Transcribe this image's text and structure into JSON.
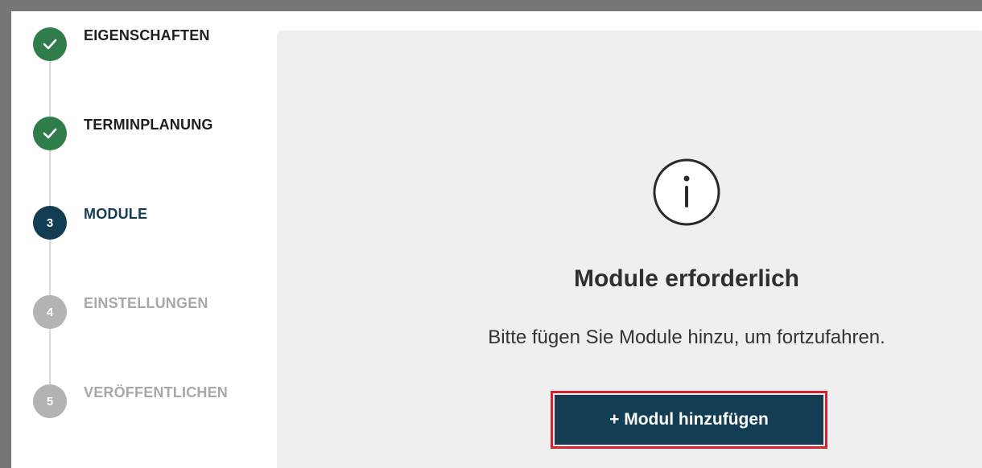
{
  "stepper": {
    "steps": [
      {
        "number": "",
        "label": "EIGENSCHAFTEN",
        "state": "done",
        "icon": "check-icon"
      },
      {
        "number": "",
        "label": "TERMINPLANUNG",
        "state": "done",
        "icon": "check-icon"
      },
      {
        "number": "3",
        "label": "MODULE",
        "state": "current"
      },
      {
        "number": "4",
        "label": "EINSTELLUNGEN",
        "state": "todo"
      },
      {
        "number": "5",
        "label": "VERÖFFENTLICHEN",
        "state": "todo"
      }
    ]
  },
  "main": {
    "icon": "info-icon",
    "title": "Module erforderlich",
    "message": "Bitte fügen Sie Module hinzu, um fortzufahren.",
    "add_button_label": "+ Modul hinzufügen"
  },
  "colors": {
    "done": "#2e7d4a",
    "current": "#123d52",
    "todo": "#b3b3b3",
    "highlight": "#d6202c",
    "panel_bg": "#efefef"
  }
}
